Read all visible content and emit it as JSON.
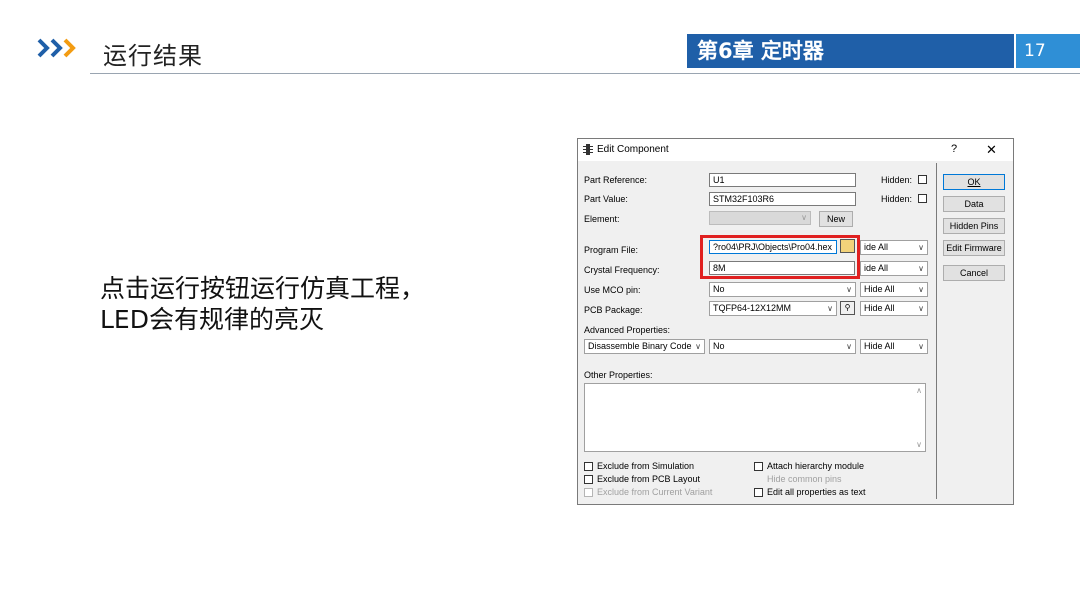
{
  "slide": {
    "title": "运行结果",
    "chapter": "第6章 定时器",
    "page": "17",
    "body_line1": "点击运行按钮运行仿真工程，",
    "body_line2": "LED会有规律的亮灭",
    "accent_color": "#1f5fa8",
    "page_color": "#2f8fd6",
    "highlight_color": "#e02020"
  },
  "dialog": {
    "title": "Edit Component",
    "help": "?",
    "close": "✕",
    "part_reference_label": "Part Reference:",
    "part_reference_value": "U1",
    "part_value_label": "Part Value:",
    "part_value_value": "STM32F103R6",
    "element_label": "Element:",
    "new_button": "New",
    "hidden_label_1": "Hidden:",
    "hidden_label_2": "Hidden:",
    "program_file_label": "Program File:",
    "program_file_value": "?ro04\\PRJ\\Objects\\Pro04.hex",
    "crystal_label": "Crystal Frequency:",
    "crystal_value": "8M",
    "mco_label": "Use MCO pin:",
    "mco_value": "No",
    "pcb_label": "PCB Package:",
    "pcb_value": "TQFP64-12X12MM",
    "hide_all": "Hide All",
    "hide_all_pf": "ide All",
    "advanced_label": "Advanced Properties:",
    "advanced_name": "Disassemble Binary Code",
    "advanced_value": "No",
    "other_label": "Other Properties:",
    "buttons": {
      "ok": "OK",
      "data": "Data",
      "hidden_pins": "Hidden Pins",
      "edit_firmware": "Edit Firmware",
      "cancel": "Cancel"
    },
    "checks": {
      "excl_sim": "Exclude from Simulation",
      "excl_pcb": "Exclude from PCB Layout",
      "excl_variant": "Exclude from Current Variant",
      "attach_hier": "Attach hierarchy module",
      "hide_common": "Hide common pins",
      "edit_all": "Edit all properties as text"
    },
    "icons": {
      "folder": "folder-icon",
      "binoculars": "binoculars-icon"
    }
  }
}
